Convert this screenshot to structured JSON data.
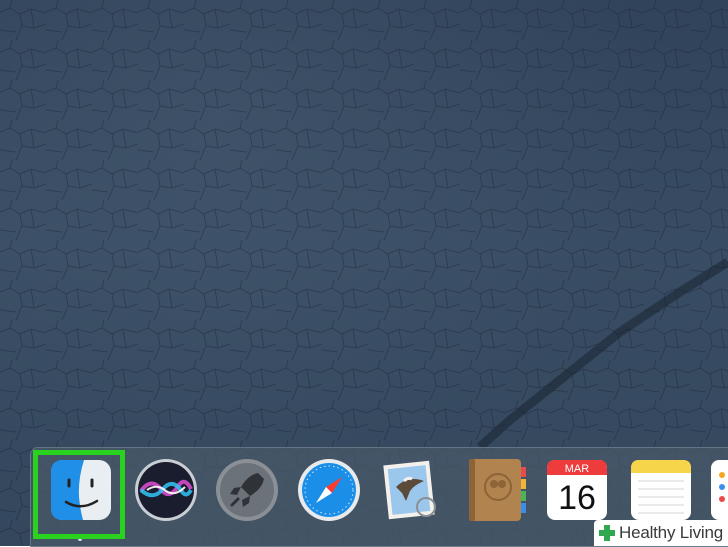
{
  "dock": {
    "items": [
      {
        "name": "Finder",
        "icon": "finder-icon",
        "selected": true
      },
      {
        "name": "Siri",
        "icon": "siri-icon"
      },
      {
        "name": "Launchpad",
        "icon": "launchpad-icon"
      },
      {
        "name": "Safari",
        "icon": "safari-icon"
      },
      {
        "name": "Mail",
        "icon": "mail-icon"
      },
      {
        "name": "Contacts",
        "icon": "contacts-icon"
      },
      {
        "name": "Calendar",
        "icon": "calendar-icon",
        "month": "MAR",
        "day": "16"
      },
      {
        "name": "Notes",
        "icon": "notes-icon"
      },
      {
        "name": "Reminders",
        "icon": "reminders-icon"
      }
    ]
  },
  "calendar": {
    "month": "MAR",
    "day": "16"
  },
  "highlight": {
    "color": "#2ad21f",
    "target": "finder-icon"
  },
  "watermark": {
    "text": "Healthy Living",
    "accent": "#2fa84f"
  }
}
